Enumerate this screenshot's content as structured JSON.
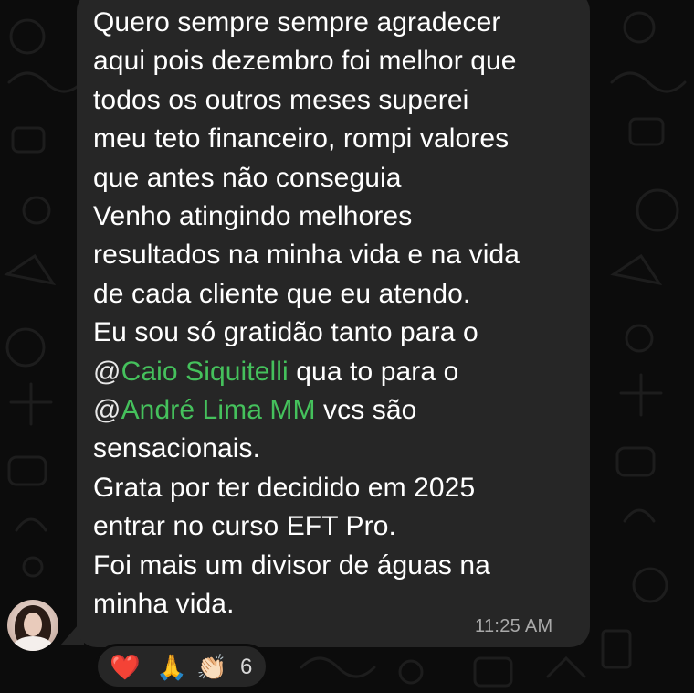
{
  "message": {
    "lines": [
      "Quero sempre sempre agradecer",
      "aqui pois dezembro foi melhor que",
      "todos os outros meses superei",
      "meu teto financeiro,  rompi valores",
      "que antes não conseguia",
      "Venho atingindo melhores",
      "resultados na minha vida e na vida",
      "de cada cliente que eu atendo.",
      "Eu sou só gratidão tanto para o"
    ],
    "mention_line_1": {
      "at": "@",
      "name": "Caio Siquitelli",
      "after": " qua to para o"
    },
    "mention_line_2": {
      "at": "@",
      "name": "André Lima MM",
      "after": " vcs são"
    },
    "lines_after": [
      "sensacionais.",
      "Grata por ter decidido em 2025",
      "entrar no curso EFT Pro.",
      "Foi mais um divisor de águas na",
      "minha vida."
    ],
    "timestamp": "11:25 AM"
  },
  "reactions": {
    "emojis": [
      "❤️",
      "🙏",
      "👏🏻"
    ],
    "count": "6"
  },
  "colors": {
    "bubble": "#262626",
    "mention": "#45c15c",
    "background": "#0c0c0c",
    "timestamp": "#a9a9a9"
  }
}
